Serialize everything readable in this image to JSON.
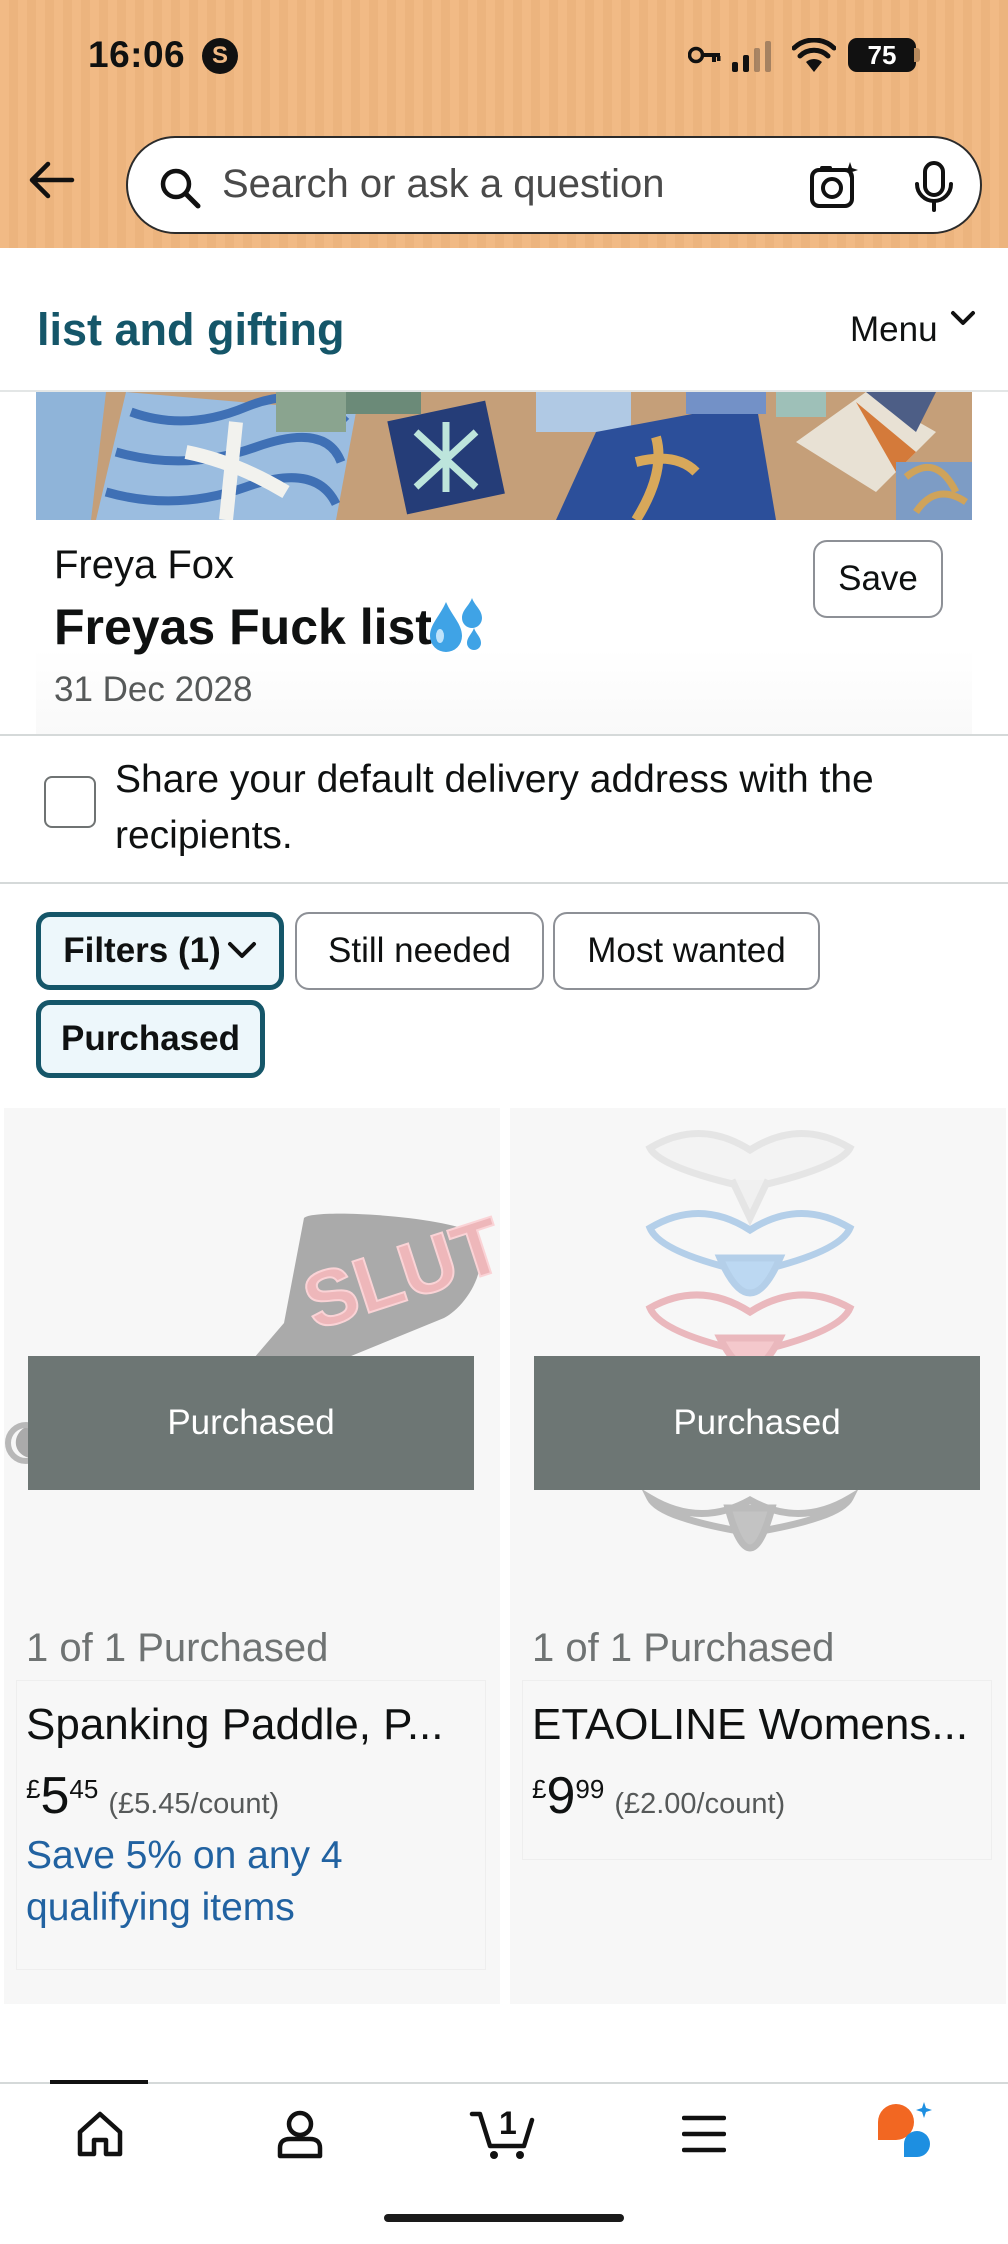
{
  "status_bar": {
    "time": "16:06",
    "carrier_badge": "S",
    "battery": "75"
  },
  "search": {
    "placeholder": "Search or ask a question"
  },
  "subnav": {
    "title": "list and gifting",
    "menu_label": "Menu"
  },
  "list": {
    "owner": "Freya Fox",
    "name": "Freyas Fuck list",
    "emoji": "💦",
    "date": "31 Dec 2028",
    "save_label": "Save"
  },
  "share": {
    "label": "Share your default delivery address with the recipients.",
    "checked": false
  },
  "filters": [
    {
      "label": "Filters (1)",
      "active": true
    },
    {
      "label": "Still needed",
      "active": false
    },
    {
      "label": "Most wanted",
      "active": false
    },
    {
      "label": "Purchased",
      "active": true
    }
  ],
  "products": [
    {
      "overlay": "Purchased",
      "purchased_count": "1 of 1 Purchased",
      "title": "Spanking Paddle, P...",
      "currency": "£",
      "price_whole": "5",
      "price_fraction": "45",
      "unit_price": "(£5.45/count)",
      "promo": "Save 5% on any 4 qualifying items",
      "image": "paddle-image"
    },
    {
      "overlay": "Purchased",
      "purchased_count": "1 of 1 Purchased",
      "title": "ETAOLINE Womens...",
      "currency": "£",
      "price_whole": "9",
      "price_fraction": "99",
      "unit_price": "(£2.00/count)",
      "promo": "",
      "image": "thong-set-image"
    }
  ],
  "bottom_nav": [
    {
      "icon": "home-icon"
    },
    {
      "icon": "account-icon"
    },
    {
      "icon": "cart-icon",
      "badge": "1"
    },
    {
      "icon": "menu-icon"
    },
    {
      "icon": "rufus-assistant-icon"
    }
  ],
  "colors": {
    "header_bg": "#f1ba85",
    "title_teal": "#155669",
    "link_blue": "#2162a1",
    "overlay_gray": "#6d7674",
    "assistant_orange": "#f26722",
    "assistant_blue": "#1d8fe1"
  }
}
